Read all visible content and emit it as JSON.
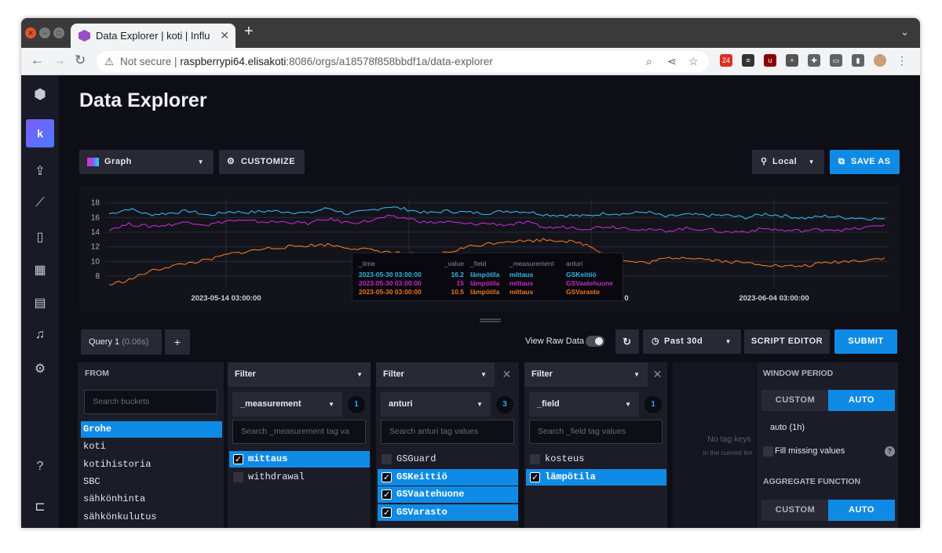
{
  "browser": {
    "tab_title": "Data Explorer | koti | Influ",
    "url_warning": "Not secure",
    "url_host": "raspberrypi64.elisakoti",
    "url_path": ":8086/orgs/a18578f858bbdf1a/data-explorer",
    "ext_badge": "24"
  },
  "sidebar": {
    "org_initial": "k"
  },
  "page": {
    "title": "Data Explorer"
  },
  "toolbar": {
    "view_type": "Graph",
    "customize": "CUSTOMIZE",
    "timezone": "Local",
    "save_as": "SAVE AS"
  },
  "chart_data": {
    "type": "line",
    "y_ticks": [
      "18",
      "16",
      "14",
      "12",
      "10",
      "8"
    ],
    "ylim": [
      6.5,
      18.5
    ],
    "x_tick_labels": [
      "2023-05-14 03:00:00",
      "0",
      "2023-06-04 03:00:00"
    ],
    "series": [
      {
        "name": "GSKeittiö",
        "color": "#32b6e8",
        "values": [
          16.5,
          17.2,
          16.4,
          16.6,
          16.9,
          16.3,
          16.8,
          16.7,
          16.9,
          16.8,
          16.6,
          17.3,
          16.5,
          16.9,
          17.5,
          17.1,
          16.6,
          16.9,
          16.7,
          16.6,
          16.9,
          16.8,
          16.4,
          16.3,
          16.2,
          16.6,
          16.5,
          16.8,
          16.1,
          16.4,
          16.3,
          16.3,
          16.0,
          16.5,
          16.2,
          15.9,
          16.2,
          16.0,
          15.9,
          15.8
        ]
      },
      {
        "name": "GSVaatehuone",
        "color": "#c42bc4",
        "values": [
          14.4,
          15.1,
          14.8,
          15.0,
          15.4,
          15.0,
          15.6,
          15.5,
          15.4,
          15.4,
          15.2,
          15.8,
          15.3,
          15.5,
          16.1,
          15.9,
          15.3,
          15.4,
          15.1,
          15.2,
          15.0,
          15.3,
          14.6,
          14.7,
          14.5,
          14.8,
          14.6,
          14.3,
          14.2,
          14.5,
          14.4,
          14.0,
          14.1,
          14.5,
          14.2,
          14.2,
          14.4,
          14.3,
          14.6,
          15.0
        ]
      },
      {
        "name": "GSVarasto",
        "color": "#e87820",
        "values": [
          6.8,
          7.5,
          8.6,
          9.3,
          9.8,
          10.2,
          11.0,
          11.4,
          11.8,
          12.0,
          12.2,
          12.3,
          11.9,
          11.6,
          11.3,
          11.0,
          10.9,
          11.2,
          12.0,
          12.4,
          12.8,
          12.8,
          13.0,
          12.8,
          12.3,
          11.0,
          10.0,
          9.8,
          10.4,
          10.6,
          10.3,
          10.0,
          9.8,
          9.6,
          9.3,
          9.4,
          9.8,
          10.0,
          10.2,
          10.5
        ]
      }
    ],
    "tooltip": {
      "headers": [
        "_time",
        "_value",
        "_field",
        "_measurement",
        "anturi"
      ],
      "rows": [
        {
          "time": "2023-05-30 03:00:00",
          "value": "16.2",
          "field": "lämpötila",
          "measurement": "mittaus",
          "anturi": "GSKeittiö",
          "color": "#32b6e8"
        },
        {
          "time": "2023-05-30 03:00:00",
          "value": "15",
          "field": "lämpötila",
          "measurement": "mittaus",
          "anturi": "GSVaatehuone",
          "color": "#c42bc4"
        },
        {
          "time": "2023-05-30 03:00:00",
          "value": "10.5",
          "field": "lämpötila",
          "measurement": "mittaus",
          "anturi": "GSVarasto",
          "color": "#e87820"
        }
      ]
    }
  },
  "query": {
    "tab": "Query 1",
    "time": "(0.06s)",
    "add": "+",
    "raw_label": "View Raw Data",
    "range": "Past 30d",
    "script_editor": "SCRIPT EDITOR",
    "submit": "SUBMIT"
  },
  "from": {
    "header": "FROM",
    "search_placeholder": "Search buckets",
    "buckets": [
      "Grohe",
      "koti",
      "kotihistoria",
      "SBC",
      "sähkönhinta",
      "sähkönkulutus"
    ]
  },
  "filters": [
    {
      "header": "Filter",
      "key": "_measurement",
      "count": "1",
      "search": "Search _measurement tag va",
      "values": [
        {
          "label": "mittaus",
          "selected": true
        },
        {
          "label": "withdrawal",
          "selected": false
        }
      ]
    },
    {
      "header": "Filter",
      "key": "anturi",
      "count": "3",
      "search": "Search anturi tag values",
      "values": [
        {
          "label": "GSGuard",
          "selected": false
        },
        {
          "label": "GSKeittiö",
          "selected": true
        },
        {
          "label": "GSVaatehuone",
          "selected": true
        },
        {
          "label": "GSVarasto",
          "selected": true
        }
      ]
    },
    {
      "header": "Filter",
      "key": "_field",
      "count": "1",
      "search": "Search _field tag values",
      "values": [
        {
          "label": "kosteus",
          "selected": false
        },
        {
          "label": "lämpötila",
          "selected": true
        }
      ]
    }
  ],
  "empty_panel": {
    "line1": "No tag keys",
    "line2": "in the current tim"
  },
  "window": {
    "period_header": "WINDOW PERIOD",
    "custom": "CUSTOM",
    "auto": "AUTO",
    "auto_value": "auto (1h)",
    "fill_missing": "Fill missing values",
    "agg_header": "AGGREGATE FUNCTION",
    "agg_custom": "CUSTOM",
    "agg_auto": "AUTO"
  }
}
